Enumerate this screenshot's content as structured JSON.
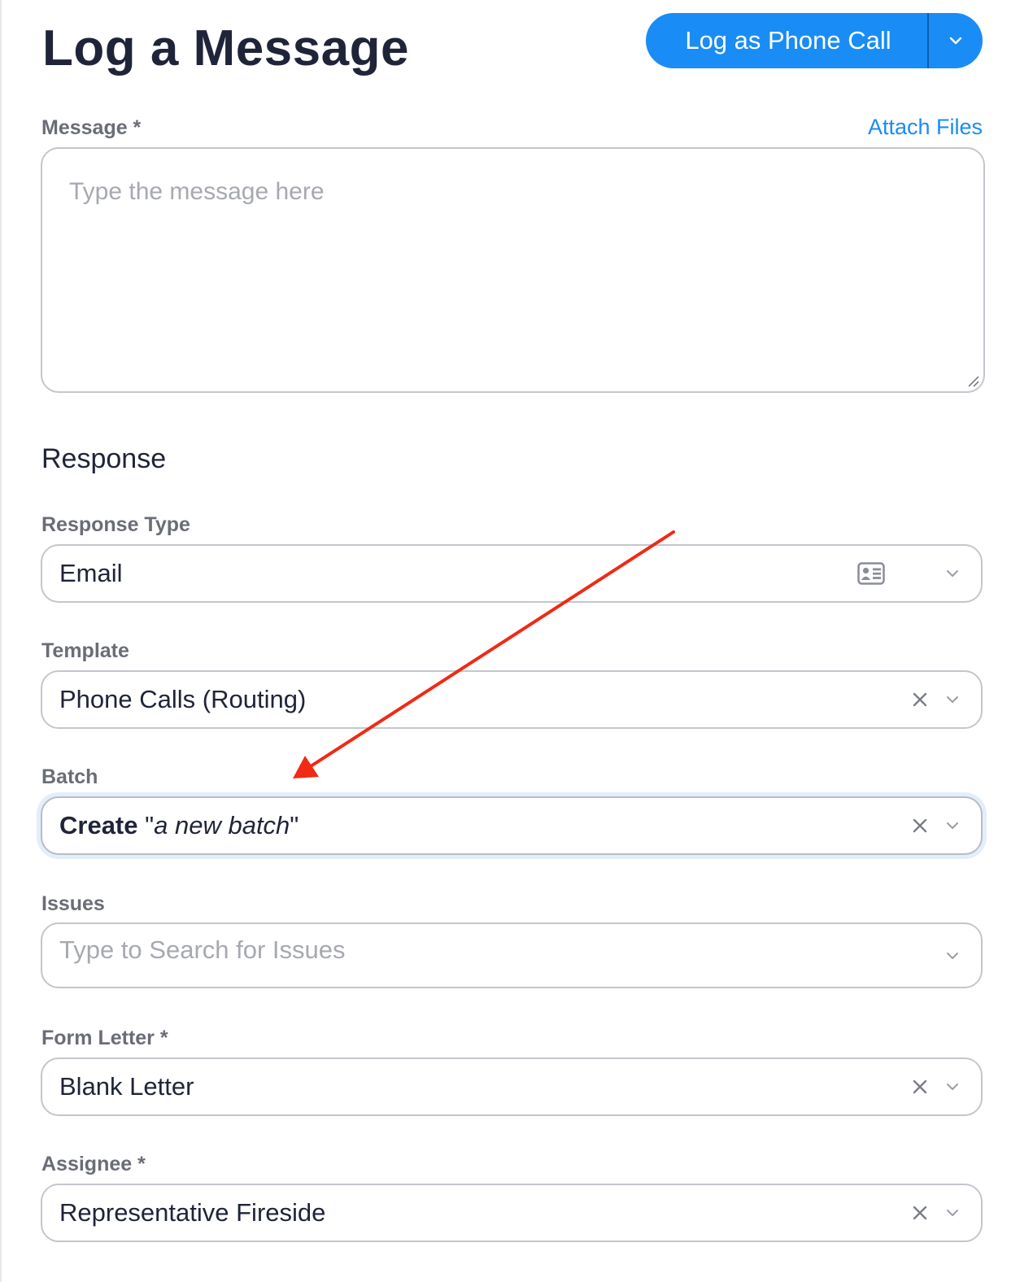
{
  "header": {
    "title": "Log a Message",
    "primary_action_label": "Log as Phone Call"
  },
  "message": {
    "label": "Message *",
    "attach_label": "Attach Files",
    "placeholder": "Type the message here",
    "value": ""
  },
  "response": {
    "section_title": "Response",
    "response_type": {
      "label": "Response Type",
      "value": "Email",
      "icon": "contact-card-icon"
    },
    "template": {
      "label": "Template",
      "value": "Phone Calls (Routing)"
    },
    "batch": {
      "label": "Batch",
      "value_prefix": "Create",
      "value_quote_open": " \"",
      "value_italic": "a new batch",
      "value_quote_close": "\""
    },
    "issues": {
      "label": "Issues",
      "placeholder": "Type to Search for Issues"
    },
    "form_letter": {
      "label": "Form Letter *",
      "value": "Blank Letter"
    },
    "assignee": {
      "label": "Assignee *",
      "value": "Representative Fireside"
    }
  },
  "colors": {
    "accent": "#1a8cf5",
    "annotation": "#f02a14",
    "text": "#1f2438",
    "label": "#6a6d76"
  }
}
